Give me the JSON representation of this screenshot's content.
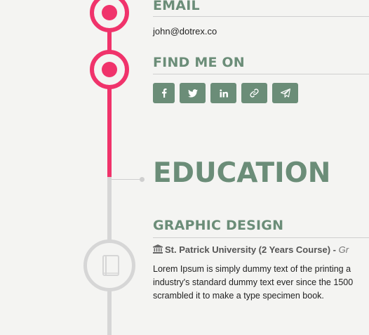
{
  "contact": {
    "email_heading": "EMAIL",
    "email_value": "john@dotrex.co",
    "find_me_heading": "FIND ME ON",
    "socials": [
      {
        "icon": "facebook-icon"
      },
      {
        "icon": "twitter-icon"
      },
      {
        "icon": "linkedin-icon"
      },
      {
        "icon": "link-icon"
      },
      {
        "icon": "telegram-icon"
      }
    ]
  },
  "education": {
    "heading": "EDUCATION",
    "items": [
      {
        "title": "GRAPHIC DESIGN",
        "institution": "St. Patrick University (2 Years Course)",
        "separator": "-",
        "period_partial": "Gr",
        "description_lines": [
          "Lorem Ipsum is simply dummy text of the printing a",
          "industry's standard dummy text ever since the 1500",
          "scrambled it to make a type specimen book."
        ]
      }
    ]
  },
  "colors": {
    "accent": "#f0336b",
    "heading": "#6b8d78",
    "timeline_inactive": "#d6d6d6"
  }
}
